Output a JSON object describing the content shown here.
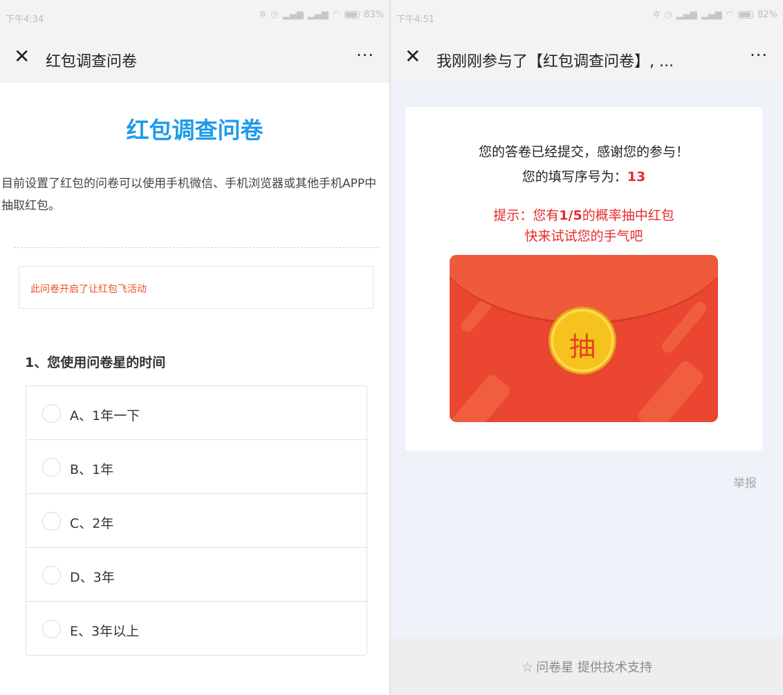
{
  "left": {
    "status": {
      "time": "下午4:34",
      "battery": "83%"
    },
    "nav": {
      "close": "✕",
      "title": "红包调查问卷",
      "more": "···"
    },
    "survey_title": "红包调查问卷",
    "description": "目前设置了红包的问卷可以使用手机微信、手机浏览器或其他手机APP中抽取红包。",
    "notice": "此问卷开启了让红包飞活动",
    "question": "1、您使用问卷星的时间",
    "options": [
      "A、1年一下",
      "B、1年",
      "C、2年",
      "D、3年",
      "E、3年以上"
    ]
  },
  "right": {
    "status": {
      "time": "下午4:51",
      "battery": "82%"
    },
    "nav": {
      "close": "✕",
      "title": "我刚刚参与了【红包调查问卷】, ...",
      "more": "···"
    },
    "thanks": "您的答卷已经提交，感谢您的参与！",
    "serial_label": "您的填写序号为：",
    "serial_number": "13",
    "hint_prefix": "提示：您有",
    "hint_prob": "1/5",
    "hint_suffix": "的概率抽中红包",
    "hint_line2": "快来试试您的手气吧",
    "draw_char": "抽",
    "report": "举报",
    "footer": "问卷星 提供技术支持"
  }
}
